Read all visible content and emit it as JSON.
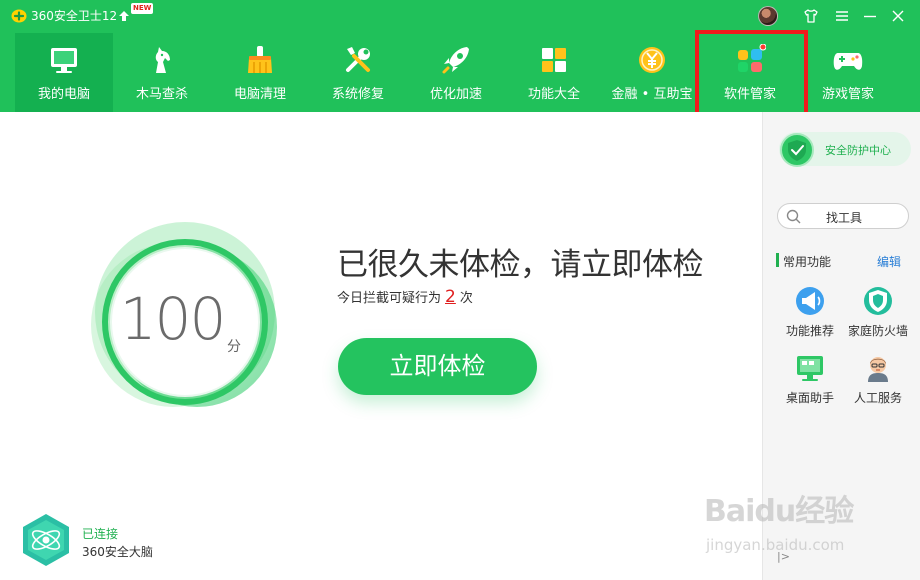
{
  "window": {
    "title": "360安全卫士12",
    "badge": "NEW",
    "icons": [
      "logo-icon",
      "upgrade-arrow-icon",
      "avatar",
      "skin-icon",
      "menu-icon",
      "minimize-icon",
      "close-icon"
    ]
  },
  "nav": {
    "items": [
      {
        "label": "我的电脑",
        "icon": "computer-icon",
        "active": true
      },
      {
        "label": "木马查杀",
        "icon": "horse-icon"
      },
      {
        "label": "电脑清理",
        "icon": "broom-icon"
      },
      {
        "label": "系统修复",
        "icon": "repair-tools-icon"
      },
      {
        "label": "优化加速",
        "icon": "rocket-icon"
      },
      {
        "label": "功能大全",
        "icon": "grid-icon"
      },
      {
        "label": "金融 • 互助宝",
        "icon": "coin-icon"
      },
      {
        "label": "软件管家",
        "icon": "software-manager-icon",
        "highlighted": true
      },
      {
        "label": "游戏管家",
        "icon": "gamepad-icon"
      }
    ]
  },
  "main": {
    "score": "100",
    "score_unit": "分",
    "headline": "已很久未体检，请立即体检",
    "subline_prefix": "今日拦截可疑行为",
    "intercept_count": "2",
    "subline_suffix": "次",
    "check_button": "立即体检",
    "brain_status": "已连接",
    "brain_label": "360安全大脑"
  },
  "sidebar": {
    "security_center": "安全防护中心",
    "find_tools": "找工具",
    "common_title": "常用功能",
    "edit_label": "编辑",
    "tools": [
      {
        "label": "功能推荐",
        "icon": "megaphone-icon"
      },
      {
        "label": "家庭防火墙",
        "icon": "firewall-shield-icon"
      },
      {
        "label": "桌面助手",
        "icon": "desktop-assistant-icon"
      },
      {
        "label": "人工服务",
        "icon": "support-agent-icon"
      }
    ],
    "collapse_label": "|>"
  },
  "watermark": {
    "logo": "Baidu经验",
    "url": "jingyan.baidu.com"
  },
  "colors": {
    "brand_green": "#20c15a",
    "active_tab": "#14b050",
    "highlight_red": "#f01c1c",
    "count_red": "#e02020",
    "link_blue": "#2a7fd6"
  }
}
